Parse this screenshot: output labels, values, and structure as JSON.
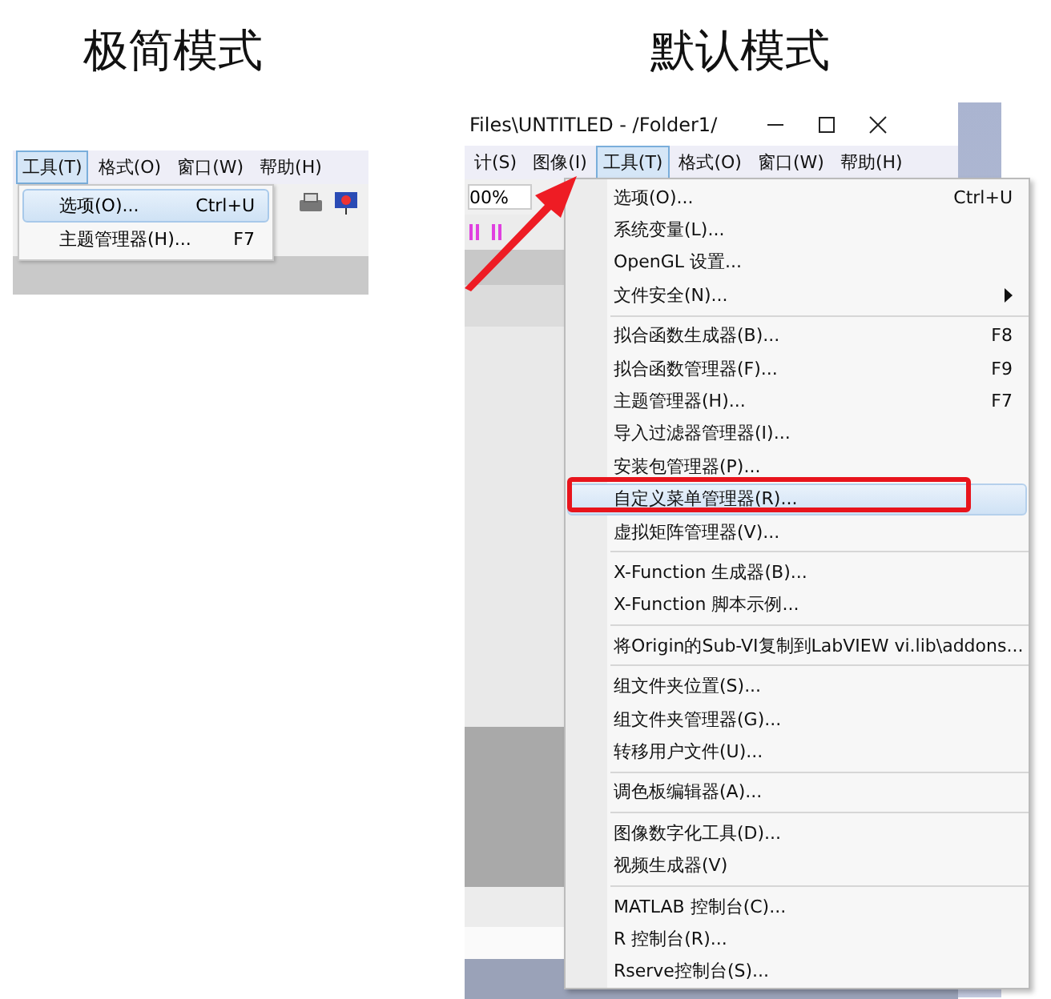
{
  "minimal": {
    "title": "极简模式",
    "menubar": [
      {
        "label": "工具(T)",
        "selected": true
      },
      {
        "label": "格式(O)",
        "selected": false
      },
      {
        "label": "窗口(W)",
        "selected": false
      },
      {
        "label": "帮助(H)",
        "selected": false
      }
    ],
    "menu": [
      {
        "label": "选项(O)...",
        "shortcut": "Ctrl+U",
        "selected": true
      },
      {
        "label": "主题管理器(H)...",
        "shortcut": "F7",
        "selected": false
      }
    ]
  },
  "default": {
    "title": "默认模式",
    "window_title": "Files\\UNTITLED - /Folder1/",
    "zoom_field": "00%",
    "menubar": [
      {
        "label": "计(S)",
        "selected": false
      },
      {
        "label": "图像(I)",
        "selected": false
      },
      {
        "label": "工具(T)",
        "selected": true
      },
      {
        "label": "格式(O)",
        "selected": false
      },
      {
        "label": "窗口(W)",
        "selected": false
      },
      {
        "label": "帮助(H)",
        "selected": false
      }
    ],
    "menu": [
      {
        "kind": "item",
        "label": "选项(O)...",
        "shortcut": "Ctrl+U",
        "selected": false
      },
      {
        "kind": "item",
        "label": "系统变量(L)...",
        "selected": false
      },
      {
        "kind": "item",
        "label": "OpenGL 设置...",
        "selected": false
      },
      {
        "kind": "submenu",
        "label": "文件安全(N)...",
        "selected": false
      },
      {
        "kind": "separator"
      },
      {
        "kind": "item",
        "label": "拟合函数生成器(B)...",
        "shortcut": "F8",
        "selected": false
      },
      {
        "kind": "item",
        "label": "拟合函数管理器(F)...",
        "shortcut": "F9",
        "selected": false
      },
      {
        "kind": "item",
        "label": "主题管理器(H)...",
        "shortcut": "F7",
        "selected": false
      },
      {
        "kind": "item",
        "label": "导入过滤器管理器(I)...",
        "selected": false
      },
      {
        "kind": "item",
        "label": "安装包管理器(P)...",
        "selected": false
      },
      {
        "kind": "item",
        "label": "自定义菜单管理器(R)...",
        "selected": true
      },
      {
        "kind": "item",
        "label": "虚拟矩阵管理器(V)...",
        "selected": false
      },
      {
        "kind": "separator"
      },
      {
        "kind": "item",
        "label": "X-Function 生成器(B)...",
        "selected": false
      },
      {
        "kind": "item",
        "label": "X-Function 脚本示例...",
        "selected": false
      },
      {
        "kind": "separator"
      },
      {
        "kind": "item",
        "label": "将Origin的Sub-VI复制到LabVIEW vi.lib\\addons...",
        "selected": false
      },
      {
        "kind": "separator"
      },
      {
        "kind": "item",
        "label": "组文件夹位置(S)...",
        "selected": false
      },
      {
        "kind": "item",
        "label": "组文件夹管理器(G)...",
        "selected": false
      },
      {
        "kind": "item",
        "label": "转移用户文件(U)...",
        "selected": false
      },
      {
        "kind": "separator"
      },
      {
        "kind": "item",
        "label": "调色板编辑器(A)...",
        "selected": false
      },
      {
        "kind": "separator"
      },
      {
        "kind": "item",
        "label": "图像数字化工具(D)...",
        "selected": false
      },
      {
        "kind": "item",
        "label": "视频生成器(V)",
        "selected": false
      },
      {
        "kind": "separator"
      },
      {
        "kind": "item",
        "label": "MATLAB 控制台(C)...",
        "selected": false
      },
      {
        "kind": "item",
        "label": "R 控制台(R)...",
        "selected": false
      },
      {
        "kind": "item",
        "label": "Rserve控制台(S)...",
        "selected": false
      }
    ]
  }
}
